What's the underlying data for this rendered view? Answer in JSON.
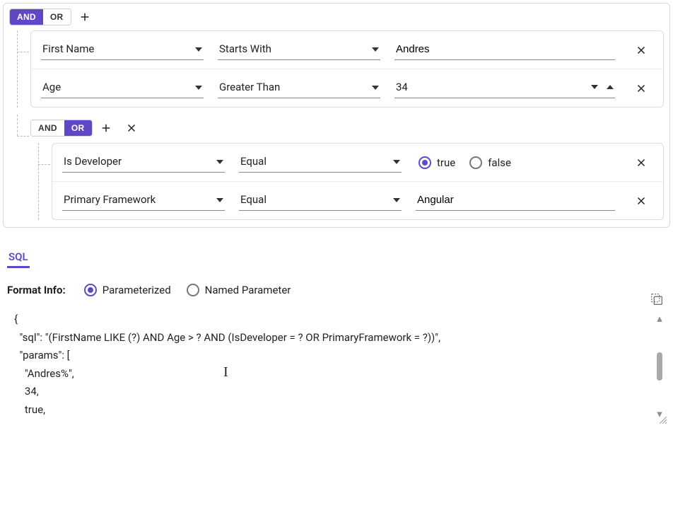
{
  "root": {
    "operator": {
      "and": "AND",
      "or": "OR",
      "active": "AND"
    },
    "conditions": [
      {
        "field": "First Name",
        "op": "Starts With",
        "value_text": "Andres"
      },
      {
        "field": "Age",
        "op": "Greater Than",
        "value_num": "34"
      }
    ],
    "subgroup": {
      "operator": {
        "and": "AND",
        "or": "OR",
        "active": "OR"
      },
      "conditions": [
        {
          "field": "Is Developer",
          "op": "Equal",
          "value_bool_true": "true",
          "value_bool_false": "false",
          "selected": "true"
        },
        {
          "field": "Primary Framework",
          "op": "Equal",
          "value_text": "Angular"
        }
      ]
    }
  },
  "output": {
    "tab": "SQL",
    "format_label": "Format Info:",
    "format_options": {
      "parameterized": "Parameterized",
      "named": "Named Parameter",
      "selected": "parameterized"
    },
    "code": "{\n  \"sql\": \"(FirstName LIKE (?) AND Age > ? AND (IsDeveloper = ? OR PrimaryFramework = ?))\",\n  \"params\": [\n    \"Andres%\",\n    34,\n    true,"
  }
}
